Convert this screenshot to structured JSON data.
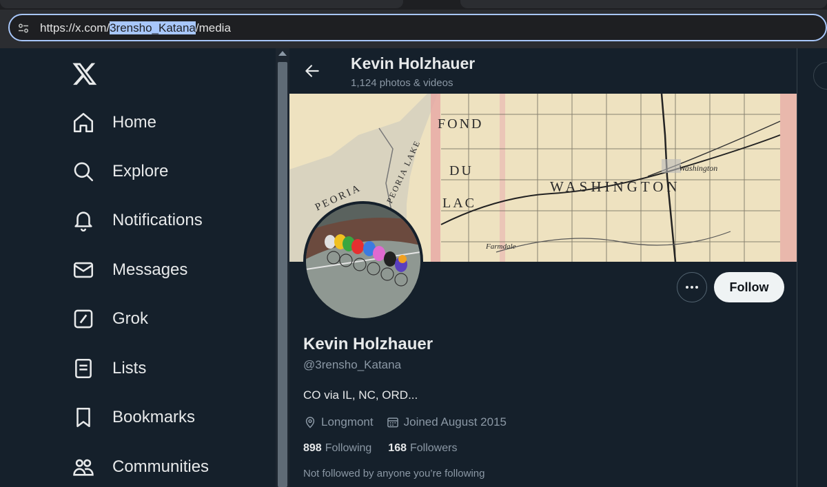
{
  "browser": {
    "url_prefix": "https://x.com/",
    "url_selected": "3rensho_Katana",
    "url_suffix": "/media"
  },
  "nav": {
    "items": [
      {
        "label": "Home",
        "icon": "home-icon"
      },
      {
        "label": "Explore",
        "icon": "search-icon"
      },
      {
        "label": "Notifications",
        "icon": "bell-icon"
      },
      {
        "label": "Messages",
        "icon": "envelope-icon"
      },
      {
        "label": "Grok",
        "icon": "grok-icon"
      },
      {
        "label": "Lists",
        "icon": "list-icon"
      },
      {
        "label": "Bookmarks",
        "icon": "bookmark-icon"
      },
      {
        "label": "Communities",
        "icon": "communities-icon"
      }
    ]
  },
  "header": {
    "name": "Kevin Holzhauer",
    "count": "1,124 photos & videos"
  },
  "profile": {
    "name": "Kevin Holzhauer",
    "handle": "@3rensho_Katana",
    "bio": "CO via IL, NC, ORD...",
    "location": "Longmont",
    "joined": "Joined August 2015",
    "following_count": "898",
    "following_label": "Following",
    "followers_count": "168",
    "followers_label": "Followers",
    "note": "Not followed by anyone you’re following",
    "follow_label": "Follow"
  },
  "banner_map": {
    "labels": [
      "FOND",
      "DU",
      "LAC",
      "WASHINGTON",
      "PEORIA",
      "PEORIA LAKE",
      "Washington",
      "Farmdale"
    ]
  },
  "colors": {
    "background": "#15202b",
    "text": "#e7e9ea",
    "secondary": "#8b98a5",
    "accent_selection": "#a8c7fa"
  }
}
